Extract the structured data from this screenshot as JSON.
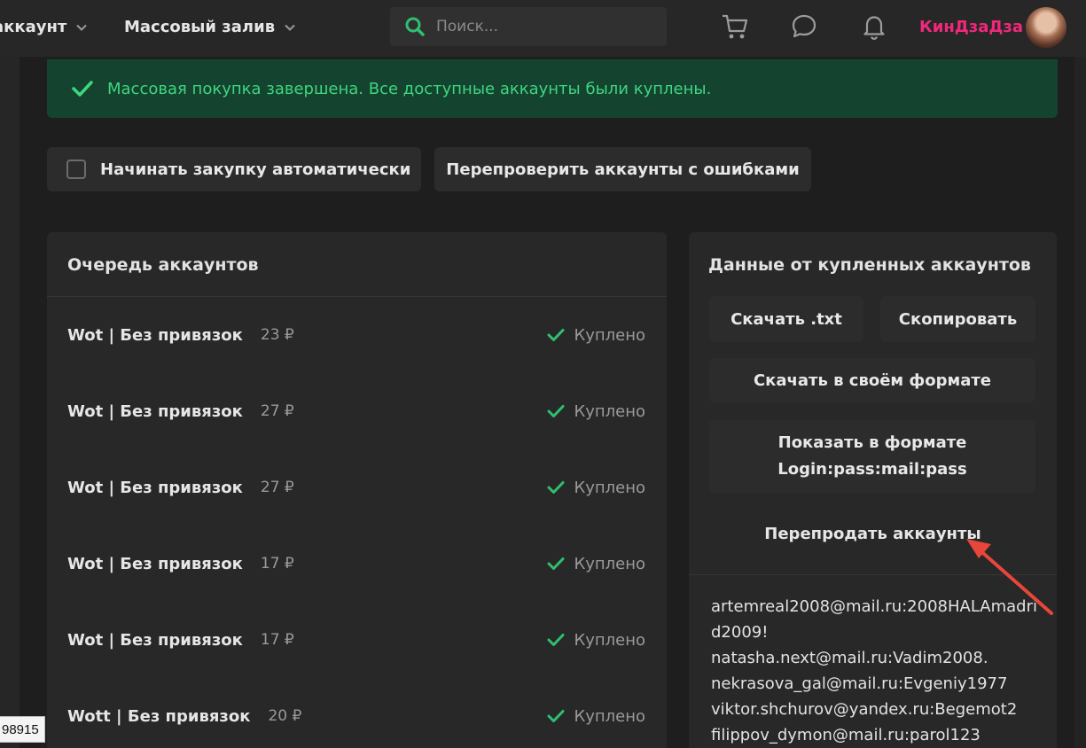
{
  "header": {
    "nav_account": "аккаунт",
    "nav_mass": "Массовый залив",
    "search_placeholder": "Поиск...",
    "username": "КинДзаДза"
  },
  "alert": {
    "text": "Массовая покупка завершена. Все доступные аккаунты были куплены."
  },
  "actions": {
    "auto_buy": "Начинать закупку автоматически",
    "recheck": "Перепроверить аккаунты с ошибками"
  },
  "queue": {
    "title": "Очередь аккаунтов",
    "items": [
      {
        "name": "Wot | Без привязок",
        "price": "23 ₽",
        "status": "Куплено"
      },
      {
        "name": "Wot | Без привязок",
        "price": "27 ₽",
        "status": "Куплено"
      },
      {
        "name": "Wot | Без привязок",
        "price": "27 ₽",
        "status": "Куплено"
      },
      {
        "name": "Wot | Без привязок",
        "price": "17 ₽",
        "status": "Куплено"
      },
      {
        "name": "Wot | Без привязок",
        "price": "17 ₽",
        "status": "Куплено"
      },
      {
        "name": "Wott | Без привязок",
        "price": "20 ₽",
        "status": "Куплено"
      }
    ]
  },
  "data_panel": {
    "title": "Данные от купленных аккаунтов",
    "download_txt": "Скачать .txt",
    "copy": "Скопировать",
    "download_format": "Скачать в своём формате",
    "show_format_line1": "Показать в формате",
    "show_format_line2": "Login:pass:mail:pass",
    "resell": "Перепродать аккаунты",
    "lines": [
      "artemreal2008@mail.ru:2008HALAmadrid2009!",
      "natasha.next@mail.ru:Vadim2008.",
      "nekrasova_gal@mail.ru:Evgeniy1977",
      "viktor.shchurov@yandex.ru:Begemot2",
      "filippov_dymon@mail.ru:parol123"
    ]
  },
  "tooltip": {
    "text": "98915"
  },
  "colors": {
    "accent_green": "#3ed67f",
    "username_pink": "#f0287a",
    "arrow_red": "#e8463a"
  }
}
